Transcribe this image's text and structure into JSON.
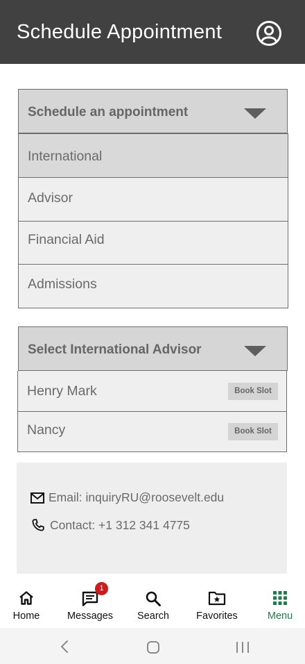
{
  "header": {
    "title": "Schedule Appointment",
    "profile_icon": "user-circle-icon"
  },
  "appointment_dropdown": {
    "label": "Schedule an appointment",
    "options": [
      {
        "label": "International",
        "selected": true
      },
      {
        "label": "Advisor",
        "selected": false
      },
      {
        "label": "Financial Aid",
        "selected": false
      },
      {
        "label": "Admissions",
        "selected": false
      }
    ]
  },
  "advisor_dropdown": {
    "label": "Select International Advisor",
    "advisors": [
      {
        "name": "Henry Mark",
        "action": "Book Slot"
      },
      {
        "name": "Nancy",
        "action": "Book Slot"
      }
    ]
  },
  "contact": {
    "email": "Email: inquiryRU@roosevelt.edu",
    "phone": "Contact: +1 312 341 4775"
  },
  "bottom_nav": {
    "items": [
      {
        "label": "Home",
        "icon": "home-icon"
      },
      {
        "label": "Messages",
        "icon": "message-icon",
        "badge": "1"
      },
      {
        "label": "Search",
        "icon": "search-icon"
      },
      {
        "label": "Favorites",
        "icon": "favorites-folder-icon"
      },
      {
        "label": "Menu",
        "icon": "grid-menu-icon",
        "active": true
      }
    ],
    "active_color": "#1e7d4a"
  },
  "colors": {
    "appbar": "#414141",
    "badge": "#d11a1a",
    "accent": "#1e7d4a"
  }
}
